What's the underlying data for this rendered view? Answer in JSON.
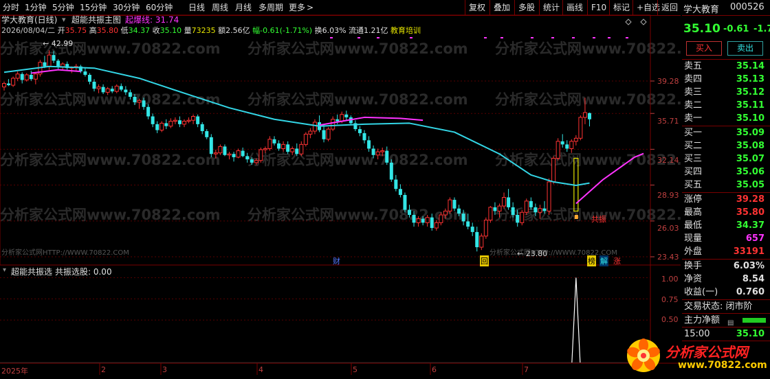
{
  "toolbar": {
    "periods": [
      "分时",
      "1分钟",
      "5分钟",
      "15分钟",
      "30分钟",
      "60分钟",
      "日线",
      "周线",
      "月线",
      "多周期",
      "更多"
    ],
    "more_arrow": ">",
    "actions": [
      "复权",
      "叠加",
      "多股",
      "统计",
      "画线",
      "F10",
      "标记",
      "+自选",
      "返回"
    ]
  },
  "stock": {
    "title": "学大教育(日线)",
    "main_indicator": "超能共振主图",
    "indicator_value": "起爆线: 31.74",
    "date": "2026/08/04/二",
    "open_label": "开",
    "open": "35.75",
    "high_label": "高",
    "high": "35.80",
    "low_label": "低",
    "low": "34.37",
    "close_label": "收",
    "close": "35.10",
    "vol_label": "量",
    "vol": "73235",
    "amount": "额2.56亿",
    "change": "幅-0.61(-1.71%)",
    "turnover": "换6.03%",
    "float": "流通1.21亿",
    "sector": "教育培训"
  },
  "chart_main": {
    "y_ticks": [
      "39.28",
      "35.71",
      "32.14",
      "28.93",
      "26.03",
      "23.43"
    ],
    "high_annotation": "42.99",
    "low_annotation": "23.80",
    "signal_text": "共振",
    "markers": [
      "财",
      "回",
      "榜",
      "解",
      "涨"
    ],
    "watermark_site": "分析家公式网www.70822.com",
    "watermark_bottom_left": "分析家公式网HTTP://WWW.70822.COM",
    "watermark_bottom_mid": "分析家公式网HTTP://WWW.70822.COM",
    "colors": {
      "ma_cyan": "#33d6e6",
      "ma_magenta": "#ff33ff",
      "up": "#ff3333",
      "down": "#33e6e6"
    }
  },
  "chart_data": [
    {
      "type": "line",
      "title": "超能共振主图",
      "candles": [
        [
          38.6,
          39.2,
          38.2,
          39.0
        ],
        [
          39.0,
          39.5,
          38.7,
          38.8
        ],
        [
          38.8,
          39.8,
          38.6,
          39.6
        ],
        [
          39.6,
          40.4,
          39.3,
          40.1
        ],
        [
          40.1,
          40.3,
          39.0,
          39.4
        ],
        [
          39.4,
          40.2,
          39.2,
          40.0
        ],
        [
          40.0,
          40.5,
          39.3,
          39.5
        ],
        [
          39.5,
          40.2,
          38.9,
          40.1
        ],
        [
          40.1,
          41.8,
          39.8,
          41.5
        ],
        [
          41.5,
          42.3,
          40.8,
          41.0
        ],
        [
          41.0,
          42.99,
          40.6,
          42.4
        ],
        [
          42.4,
          42.9,
          41.4,
          41.7
        ],
        [
          41.7,
          41.9,
          40.7,
          40.9
        ],
        [
          40.9,
          41.5,
          40.5,
          41.3
        ],
        [
          41.3,
          41.6,
          40.6,
          40.8
        ],
        [
          40.8,
          41.0,
          40.2,
          40.9
        ],
        [
          40.9,
          41.3,
          40.4,
          41.0
        ],
        [
          41.0,
          41.2,
          40.2,
          40.4
        ],
        [
          40.4,
          40.8,
          39.8,
          40.0
        ],
        [
          40.0,
          40.2,
          38.9,
          39.2
        ],
        [
          39.2,
          39.5,
          38.1,
          38.4
        ],
        [
          38.4,
          38.9,
          37.9,
          38.6
        ],
        [
          38.6,
          38.9,
          37.8,
          38.0
        ],
        [
          38.0,
          38.6,
          37.7,
          38.4
        ],
        [
          38.4,
          38.7,
          37.9,
          38.1
        ],
        [
          38.1,
          38.9,
          37.9,
          38.7
        ],
        [
          38.7,
          39.0,
          38.1,
          38.3
        ],
        [
          38.3,
          38.7,
          37.7,
          38.0
        ],
        [
          38.0,
          38.3,
          37.2,
          37.5
        ],
        [
          37.5,
          37.8,
          36.6,
          36.9
        ],
        [
          36.9,
          37.3,
          36.2,
          37.1
        ],
        [
          37.1,
          37.4,
          36.1,
          36.4
        ],
        [
          36.4,
          36.7,
          35.1,
          35.4
        ],
        [
          35.4,
          35.7,
          34.3,
          34.6
        ],
        [
          34.6,
          34.9,
          33.7,
          34.0
        ],
        [
          34.0,
          34.9,
          33.8,
          34.7
        ],
        [
          34.7,
          35.1,
          34.1,
          34.4
        ],
        [
          34.4,
          35.2,
          34.2,
          34.9
        ],
        [
          34.9,
          35.3,
          34.6,
          35.0
        ],
        [
          35.0,
          35.4,
          34.3,
          34.6
        ],
        [
          34.6,
          35.1,
          34.3,
          34.9
        ],
        [
          34.9,
          35.3,
          34.7,
          35.0
        ],
        [
          35.0,
          35.6,
          34.6,
          35.4
        ],
        [
          35.4,
          35.6,
          34.3,
          34.6
        ],
        [
          34.6,
          34.8,
          33.6,
          33.9
        ],
        [
          33.9,
          34.1,
          33.1,
          33.3
        ],
        [
          33.3,
          33.6,
          31.4,
          31.7
        ],
        [
          31.7,
          32.1,
          31.3,
          31.8
        ],
        [
          31.8,
          32.6,
          31.6,
          32.4
        ],
        [
          32.4,
          32.6,
          31.5,
          31.6
        ],
        [
          31.6,
          31.9,
          31.2,
          31.7
        ],
        [
          31.7,
          31.9,
          31.0,
          31.4
        ],
        [
          31.4,
          32.2,
          31.3,
          32.0
        ],
        [
          32.0,
          32.3,
          31.4,
          31.5
        ],
        [
          31.5,
          31.8,
          30.9,
          31.2
        ],
        [
          31.2,
          31.4,
          30.7,
          30.9
        ],
        [
          30.9,
          31.3,
          30.7,
          31.1
        ],
        [
          31.1,
          32.3,
          30.9,
          32.1
        ],
        [
          32.1,
          32.4,
          31.8,
          32.2
        ],
        [
          32.2,
          33.4,
          32.0,
          33.1
        ],
        [
          33.1,
          33.4,
          32.5,
          32.7
        ],
        [
          32.7,
          33.0,
          32.0,
          32.2
        ],
        [
          32.2,
          32.9,
          31.9,
          32.6
        ],
        [
          32.6,
          32.9,
          31.7,
          31.9
        ],
        [
          31.9,
          32.4,
          31.6,
          32.2
        ],
        [
          32.2,
          32.7,
          31.5,
          31.7
        ],
        [
          31.7,
          32.9,
          31.5,
          32.6
        ],
        [
          32.6,
          33.8,
          32.4,
          33.6
        ],
        [
          33.6,
          34.2,
          33.2,
          33.9
        ],
        [
          33.9,
          35.1,
          33.6,
          34.8
        ],
        [
          34.8,
          35.5,
          33.8,
          34.0
        ],
        [
          34.0,
          34.6,
          32.8,
          33.1
        ],
        [
          33.1,
          34.3,
          32.9,
          34.1
        ],
        [
          34.1,
          35.4,
          33.9,
          35.1
        ],
        [
          35.1,
          35.6,
          34.6,
          34.9
        ],
        [
          34.9,
          35.9,
          34.7,
          35.6
        ],
        [
          35.6,
          36.0,
          35.0,
          35.3
        ],
        [
          35.3,
          35.5,
          34.5,
          34.7
        ],
        [
          34.7,
          35.0,
          33.9,
          34.1
        ],
        [
          34.1,
          34.4,
          33.4,
          33.7
        ],
        [
          33.7,
          34.0,
          32.7,
          33.0
        ],
        [
          33.0,
          33.4,
          31.9,
          32.2
        ],
        [
          32.2,
          32.5,
          31.3,
          31.6
        ],
        [
          31.6,
          32.2,
          31.2,
          31.9
        ],
        [
          31.9,
          32.3,
          31.5,
          32.0
        ],
        [
          32.0,
          32.4,
          30.7,
          30.9
        ],
        [
          30.9,
          31.2,
          29.2,
          29.4
        ],
        [
          29.4,
          29.8,
          28.4,
          28.6
        ],
        [
          28.6,
          29.0,
          27.9,
          28.1
        ],
        [
          28.1,
          28.3,
          26.7,
          26.9
        ],
        [
          26.9,
          27.3,
          26.3,
          26.5
        ],
        [
          26.5,
          26.8,
          25.6,
          25.9
        ],
        [
          25.9,
          26.4,
          25.6,
          26.2
        ],
        [
          26.2,
          26.4,
          25.7,
          25.9
        ],
        [
          25.9,
          26.5,
          25.6,
          26.3
        ],
        [
          26.3,
          26.6,
          25.3,
          25.5
        ],
        [
          25.5,
          26.1,
          25.3,
          25.9
        ],
        [
          25.9,
          26.7,
          25.7,
          26.5
        ],
        [
          26.5,
          27.0,
          26.2,
          26.8
        ],
        [
          26.8,
          27.9,
          26.6,
          27.7
        ],
        [
          27.7,
          27.9,
          26.8,
          27.0
        ],
        [
          27.0,
          27.3,
          26.4,
          26.6
        ],
        [
          26.6,
          26.9,
          25.7,
          26.0
        ],
        [
          26.0,
          26.6,
          25.4,
          25.6
        ],
        [
          25.6,
          25.9,
          24.9,
          25.2
        ],
        [
          25.2,
          25.6,
          23.8,
          24.1
        ],
        [
          24.1,
          25.1,
          23.9,
          24.9
        ],
        [
          24.9,
          26.3,
          24.7,
          26.1
        ],
        [
          26.1,
          27.2,
          25.9,
          27.1
        ],
        [
          27.1,
          27.5,
          26.5,
          26.8
        ],
        [
          26.8,
          27.4,
          26.3,
          27.2
        ],
        [
          27.2,
          28.3,
          27.0,
          27.9
        ],
        [
          27.9,
          28.6,
          26.9,
          27.1
        ],
        [
          27.1,
          27.5,
          26.3,
          26.5
        ],
        [
          26.5,
          26.9,
          25.6,
          25.9
        ],
        [
          25.9,
          26.9,
          25.7,
          26.7
        ],
        [
          26.7,
          27.8,
          26.5,
          27.6
        ],
        [
          27.6,
          27.9,
          26.9,
          27.1
        ],
        [
          27.1,
          27.4,
          26.4,
          26.7
        ],
        [
          26.7,
          27.3,
          26.2,
          27.0
        ],
        [
          27.0,
          27.6,
          26.6,
          26.8
        ],
        [
          26.8,
          29.5,
          26.5,
          29.2
        ],
        [
          29.2,
          31.5,
          29.0,
          31.3
        ],
        [
          31.3,
          33.2,
          31.1,
          32.9
        ],
        [
          32.9,
          33.6,
          32.3,
          32.6
        ],
        [
          32.6,
          33.0,
          31.9,
          32.2
        ],
        [
          32.2,
          33.1,
          31.8,
          32.9
        ],
        [
          32.9,
          33.5,
          32.5,
          33.2
        ],
        [
          33.2,
          35.5,
          33.0,
          35.3
        ],
        [
          35.3,
          37.4,
          34.6,
          35.8
        ],
        [
          35.75,
          35.8,
          34.37,
          35.1
        ]
      ],
      "ma_cyan": [
        [
          0,
          40.3
        ],
        [
          10,
          41.0
        ],
        [
          20,
          40.8
        ],
        [
          30,
          39.6
        ],
        [
          40,
          37.9
        ],
        [
          50,
          36.3
        ],
        [
          60,
          35.1
        ],
        [
          70,
          34.4
        ],
        [
          80,
          34.6
        ],
        [
          90,
          34.7
        ],
        [
          100,
          33.8
        ],
        [
          110,
          31.7
        ],
        [
          117,
          29.8
        ],
        [
          122,
          29.2
        ],
        [
          127,
          28.9
        ],
        [
          130,
          29.1
        ]
      ],
      "ma_magenta": [
        [
          6,
          40.2
        ],
        [
          12,
          40.6
        ],
        [
          17,
          40.4
        ],
        [
          70,
          34.5
        ],
        [
          80,
          35.3
        ],
        [
          88,
          35.2
        ],
        [
          93,
          35.0
        ],
        [
          127,
          27.4
        ],
        [
          133,
          29.4
        ],
        [
          140,
          31.4
        ],
        [
          142,
          31.74
        ]
      ]
    },
    {
      "type": "line",
      "title": "超能共振选",
      "y_ticks": [
        "1.00",
        "0.75",
        "0.50"
      ],
      "ylim": [
        0,
        1.1
      ],
      "spike_index": 127,
      "values_note": "0 except 1.00 at spike_index",
      "current_label": "共振选股: 0.00"
    }
  ],
  "x_axis": {
    "year_label": "2025年",
    "months": [
      "2",
      "3",
      "4",
      "5",
      "6",
      "7"
    ]
  },
  "panel": {
    "name": "学大教育",
    "code": "000526",
    "price": "35.10",
    "chg": "-0.61",
    "pct": "-1.7",
    "buy_btn": "买入",
    "sell_btn": "卖出",
    "asks": [
      {
        "label": "卖五",
        "price": "35.14"
      },
      {
        "label": "卖四",
        "price": "35.13"
      },
      {
        "label": "卖三",
        "price": "35.12"
      },
      {
        "label": "卖二",
        "price": "35.11"
      },
      {
        "label": "卖一",
        "price": "35.10"
      }
    ],
    "bids": [
      {
        "label": "买一",
        "price": "35.09"
      },
      {
        "label": "买二",
        "price": "35.08"
      },
      {
        "label": "买三",
        "price": "35.07"
      },
      {
        "label": "买四",
        "price": "35.06"
      },
      {
        "label": "买五",
        "price": "35.05"
      }
    ],
    "stats": [
      {
        "label": "涨停",
        "value": "39.28",
        "color": "#ff3333"
      },
      {
        "label": "最高",
        "value": "35.80",
        "color": "#ff3333"
      },
      {
        "label": "最低",
        "value": "34.37",
        "color": "#33ff33"
      },
      {
        "label": "现量",
        "value": "657",
        "color": "#ff33ff"
      },
      {
        "label": "外盘",
        "value": "33191",
        "color": "#ff3333"
      }
    ],
    "stats2": [
      {
        "label": "换手",
        "value": "6.03%",
        "color": "#e0e0e0"
      },
      {
        "label": "净资",
        "value": "8.54",
        "color": "#e0e0e0"
      },
      {
        "label": "收益(一)",
        "value": "0.760",
        "color": "#e0e0e0"
      }
    ],
    "trade_status": "交易状态: 闭市阶",
    "main_flow": "主力净额",
    "time": "15:00",
    "time_price": "35.10",
    "logo_text": "分析家公式网",
    "logo_url": "www.70822.com"
  }
}
